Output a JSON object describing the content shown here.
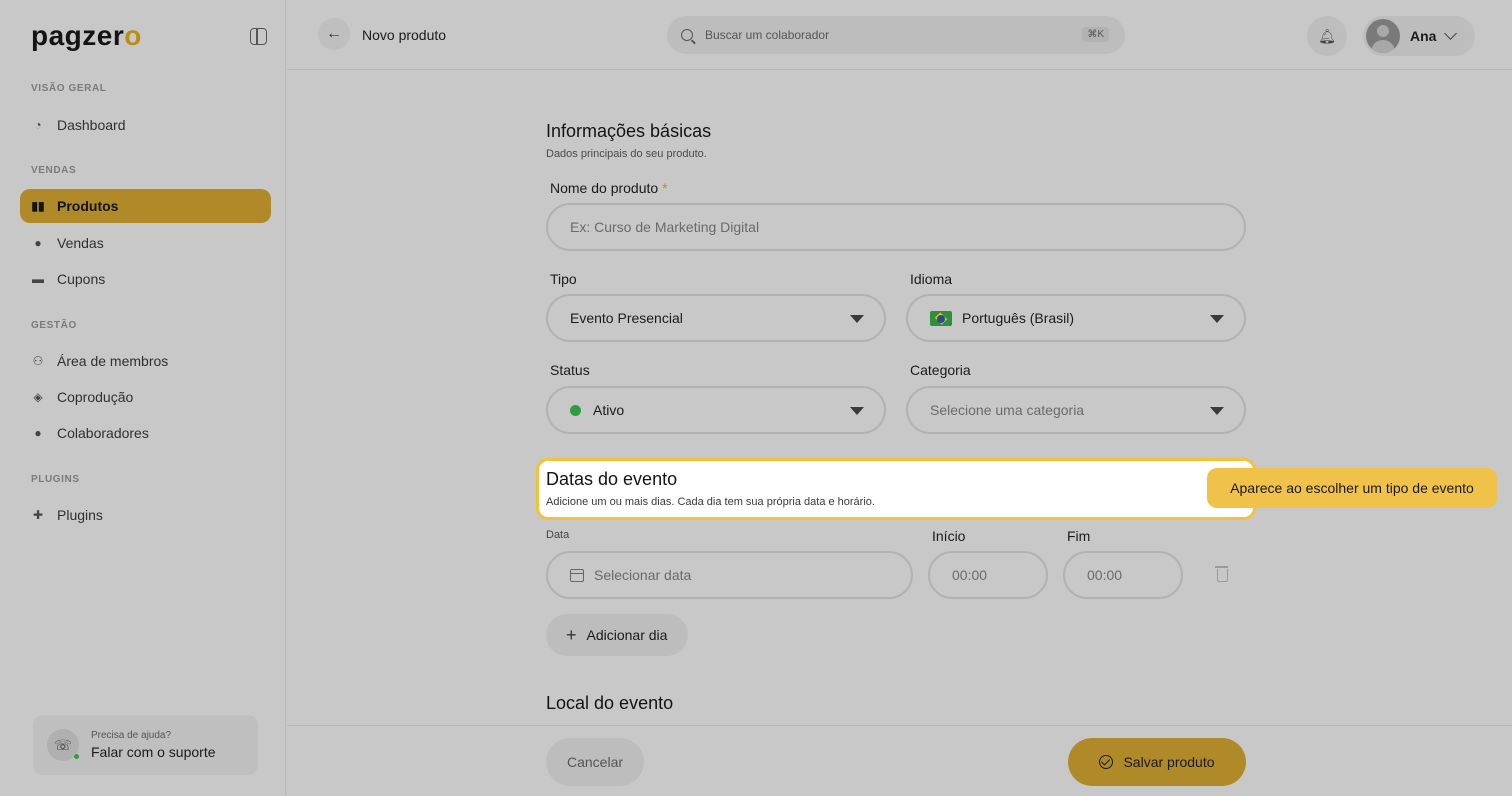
{
  "brand": {
    "logo_main": "pagzer",
    "logo_accent": "o"
  },
  "sidebar": {
    "sections": [
      {
        "label": "VISÃO GERAL"
      },
      {
        "label": "VENDAS"
      },
      {
        "label": "GESTÃO"
      },
      {
        "label": "PLUGINS"
      }
    ],
    "items": [
      {
        "label": "Dashboard",
        "icon": "dashboard-icon"
      },
      {
        "label": "Produtos",
        "icon": "products-icon",
        "active": true
      },
      {
        "label": "Vendas",
        "icon": "sales-icon"
      },
      {
        "label": "Cupons",
        "icon": "coupon-icon"
      },
      {
        "label": "Área de membros",
        "icon": "members-icon"
      },
      {
        "label": "Coprodução",
        "icon": "handshake-icon"
      },
      {
        "label": "Colaboradores",
        "icon": "user-icon"
      },
      {
        "label": "Plugins",
        "icon": "puzzle-icon"
      }
    ],
    "help": {
      "small": "Precisa de ajuda?",
      "big": "Falar com o suporte",
      "icon": "whatsapp-icon"
    }
  },
  "header": {
    "title": "Novo produto",
    "search_placeholder": "Buscar um colaborador",
    "search_shortcut": "⌘K",
    "user_name": "Ana"
  },
  "form": {
    "basic": {
      "title": "Informações básicas",
      "subtitle": "Dados principais do seu produto.",
      "name_label": "Nome do produto",
      "required_mark": "*",
      "name_placeholder": "Ex: Curso de Marketing Digital",
      "type_label": "Tipo",
      "type_value": "Evento Presencial",
      "language_label": "Idioma",
      "language_value": "Português (Brasil)",
      "status_label": "Status",
      "status_value": "Ativo",
      "category_label": "Categoria",
      "category_placeholder": "Selecione uma categoria"
    },
    "dates": {
      "title": "Datas do evento",
      "subtitle": "Adicione um ou mais dias. Cada dia tem sua própria data e horário.",
      "tooltip": "Aparece ao escolher um tipo de evento",
      "date_label": "Data",
      "date_placeholder": "Selecionar data",
      "start_label": "Início",
      "start_placeholder": "00:00",
      "end_label": "Fim",
      "end_placeholder": "00:00",
      "add_day": "Adicionar dia"
    },
    "location": {
      "title": "Local do evento"
    }
  },
  "footer": {
    "cancel": "Cancelar",
    "save": "Salvar produto"
  },
  "colors": {
    "accent": "#b08a28",
    "highlight_border": "#f2c23c",
    "tooltip_bg": "#f0c24a",
    "status_green": "#2f9d3f"
  }
}
